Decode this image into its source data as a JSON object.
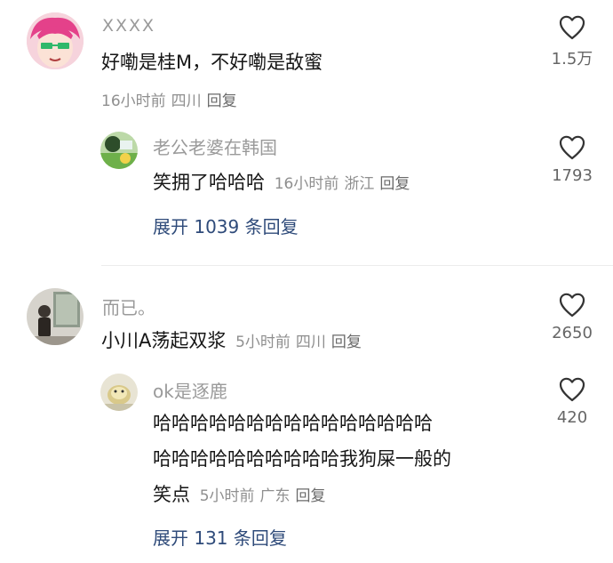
{
  "comments": [
    {
      "username": "XXXX",
      "text": "好嘞是桂M，不好嘞是敌蜜",
      "time": "16小时前",
      "location": "四川",
      "reply_label": "回复",
      "likes": "1.5万",
      "replies": [
        {
          "username": "老公老婆在韩国",
          "text": "笑拥了哈哈哈",
          "time": "16小时前",
          "location": "浙江",
          "reply_label": "回复",
          "likes": "1793"
        }
      ],
      "expand_label": "展开 1039 条回复"
    },
    {
      "username": "而已。",
      "text": "小川A荡起双浆",
      "time": "5小时前",
      "location": "四川",
      "reply_label": "回复",
      "likes": "2650",
      "replies": [
        {
          "username": "ok是逐鹿",
          "text_line1": "哈哈哈哈哈哈哈哈哈哈哈哈哈哈哈",
          "text_line2": "哈哈哈哈哈哈哈哈哈哈我狗屎一般的",
          "text_line3": "笑点",
          "time": "5小时前",
          "location": "广东",
          "reply_label": "回复",
          "likes": "420"
        }
      ],
      "expand_label": "展开 131 条回复"
    }
  ]
}
